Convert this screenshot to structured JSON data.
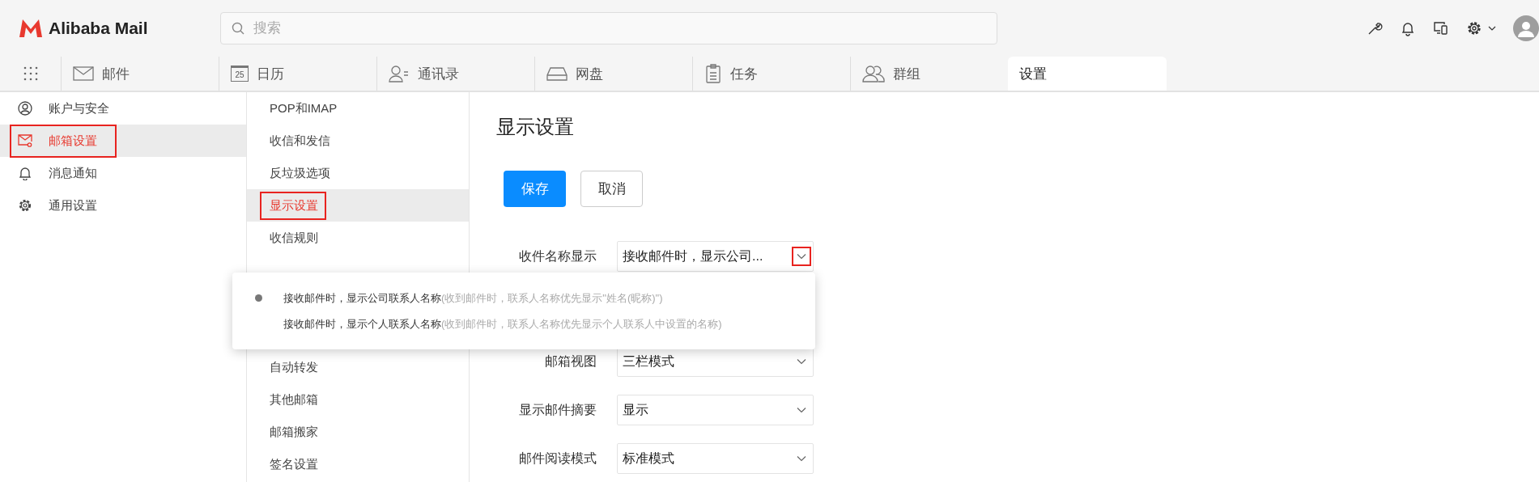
{
  "app": {
    "logo": "Alibaba Mail"
  },
  "search": {
    "placeholder": "搜索"
  },
  "nav_tabs": [
    {
      "label": "邮件",
      "selected": false
    },
    {
      "label": "日历",
      "selected": false,
      "icon_text": "25"
    },
    {
      "label": "通讯录",
      "selected": false
    },
    {
      "label": "网盘",
      "selected": false
    },
    {
      "label": "任务",
      "selected": false
    },
    {
      "label": "群组",
      "selected": false
    },
    {
      "label": "设置",
      "selected": true
    }
  ],
  "sidebar": {
    "items": [
      {
        "label": "账户与安全",
        "selected": false,
        "highlighted": false
      },
      {
        "label": "邮箱设置",
        "selected": true,
        "highlighted": true
      },
      {
        "label": "消息通知",
        "selected": false,
        "highlighted": false
      },
      {
        "label": "通用设置",
        "selected": false,
        "highlighted": false
      }
    ]
  },
  "submenu": {
    "items": [
      {
        "label": "POP和IMAP",
        "selected": false,
        "highlighted": false
      },
      {
        "label": "收信和发信",
        "selected": false,
        "highlighted": false
      },
      {
        "label": "反垃圾选项",
        "selected": false,
        "highlighted": false
      },
      {
        "label": "显示设置",
        "selected": true,
        "highlighted": true
      },
      {
        "label": "收信规则",
        "selected": false,
        "highlighted": false
      },
      {
        "label": "自动转发",
        "selected": false,
        "highlighted": false
      },
      {
        "label": "其他邮箱",
        "selected": false,
        "highlighted": false
      },
      {
        "label": "邮箱搬家",
        "selected": false,
        "highlighted": false
      },
      {
        "label": "签名设置",
        "selected": false,
        "highlighted": false
      }
    ]
  },
  "content": {
    "title": "显示设置",
    "buttons": [
      {
        "label": "保存",
        "kind": "primary"
      },
      {
        "label": "取消",
        "kind": "secondary"
      }
    ],
    "fields": [
      {
        "label": "收件名称显示",
        "value": "接收邮件时，显示公司...",
        "arrow_highlighted": true
      },
      {
        "label": "邮箱视图",
        "value": "三栏模式",
        "arrow_highlighted": false
      },
      {
        "label": "显示邮件摘要",
        "value": "显示",
        "arrow_highlighted": false
      },
      {
        "label": "邮件阅读模式",
        "value": "标准模式",
        "arrow_highlighted": false
      }
    ]
  },
  "dropdown": {
    "options": [
      {
        "label": "接收邮件时，显示公司联系人名称",
        "hint": "(收到邮件时，联系人名称优先显示\"姓名(昵称)\")",
        "selected": true
      },
      {
        "label": "接收邮件时，显示个人联系人名称",
        "hint": "(收到邮件时，联系人名称优先显示个人联系人中设置的名称)",
        "selected": false
      }
    ]
  }
}
